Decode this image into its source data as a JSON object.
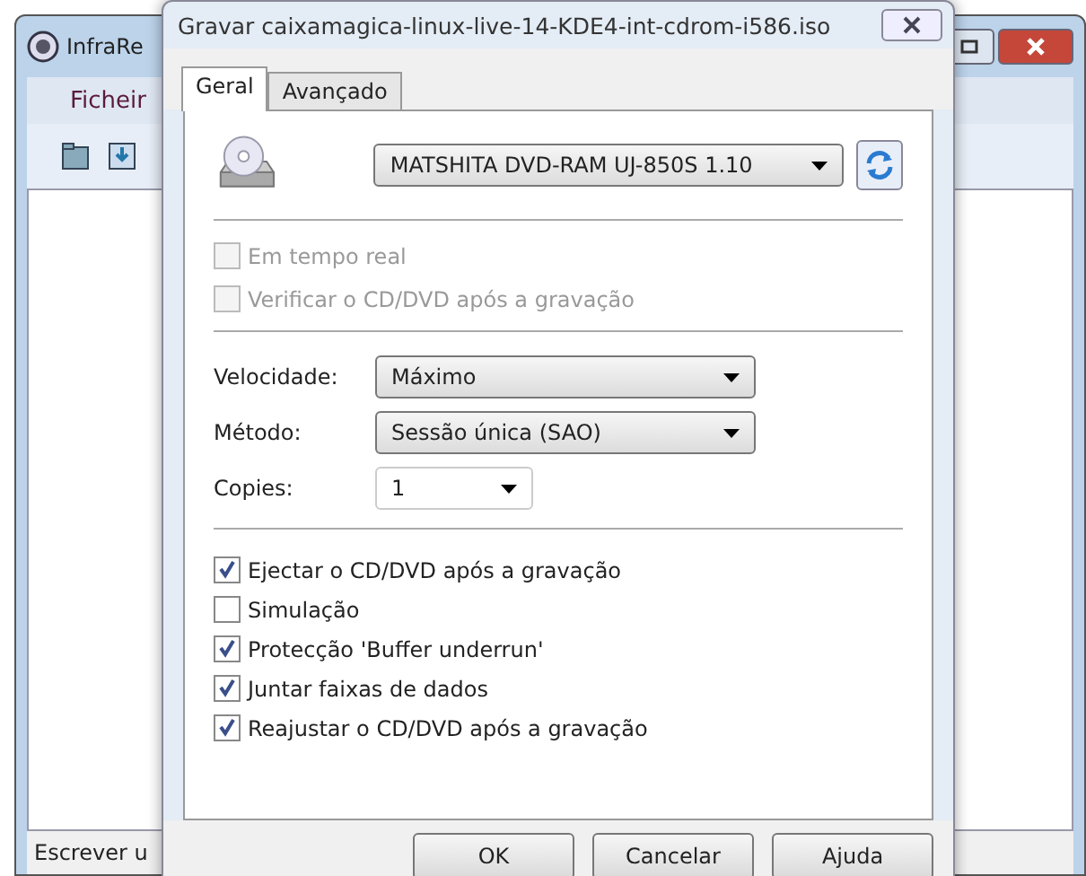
{
  "background_window": {
    "title": "InfraRe",
    "menu": [
      "Ficheir"
    ],
    "status_bar": "Escrever u"
  },
  "dialog": {
    "title": "Gravar caixamagica-linux-live-14-KDE4-int-cdrom-i586.iso",
    "tabs": [
      {
        "label": "Geral",
        "selected": true
      },
      {
        "label": "Avançado",
        "selected": false
      }
    ],
    "drive": {
      "value": "MATSHITA DVD-RAM UJ-850S 1.10"
    },
    "options_top": [
      {
        "label": "Em tempo real",
        "checked": false,
        "disabled": true
      },
      {
        "label": "Verificar o CD/DVD após a gravação",
        "checked": false,
        "disabled": true
      }
    ],
    "settings": [
      {
        "label": "Velocidade:",
        "value": "Máximo",
        "kind": "wide"
      },
      {
        "label": "Método:",
        "value": "Sessão única (SAO)",
        "kind": "wide"
      },
      {
        "label": "Copies:",
        "value": "1",
        "kind": "narrow"
      }
    ],
    "options": [
      {
        "label": "Ejectar o CD/DVD após a gravação",
        "checked": true,
        "disabled": false
      },
      {
        "label": "Simulação",
        "checked": false,
        "disabled": false
      },
      {
        "label": "Protecção 'Buffer underrun'",
        "checked": true,
        "disabled": false
      },
      {
        "label": "Juntar faixas de dados",
        "checked": true,
        "disabled": false
      },
      {
        "label": "Reajustar o CD/DVD após a gravação",
        "checked": true,
        "disabled": false
      }
    ],
    "buttons": [
      "OK",
      "Cancelar",
      "Ajuda"
    ]
  }
}
